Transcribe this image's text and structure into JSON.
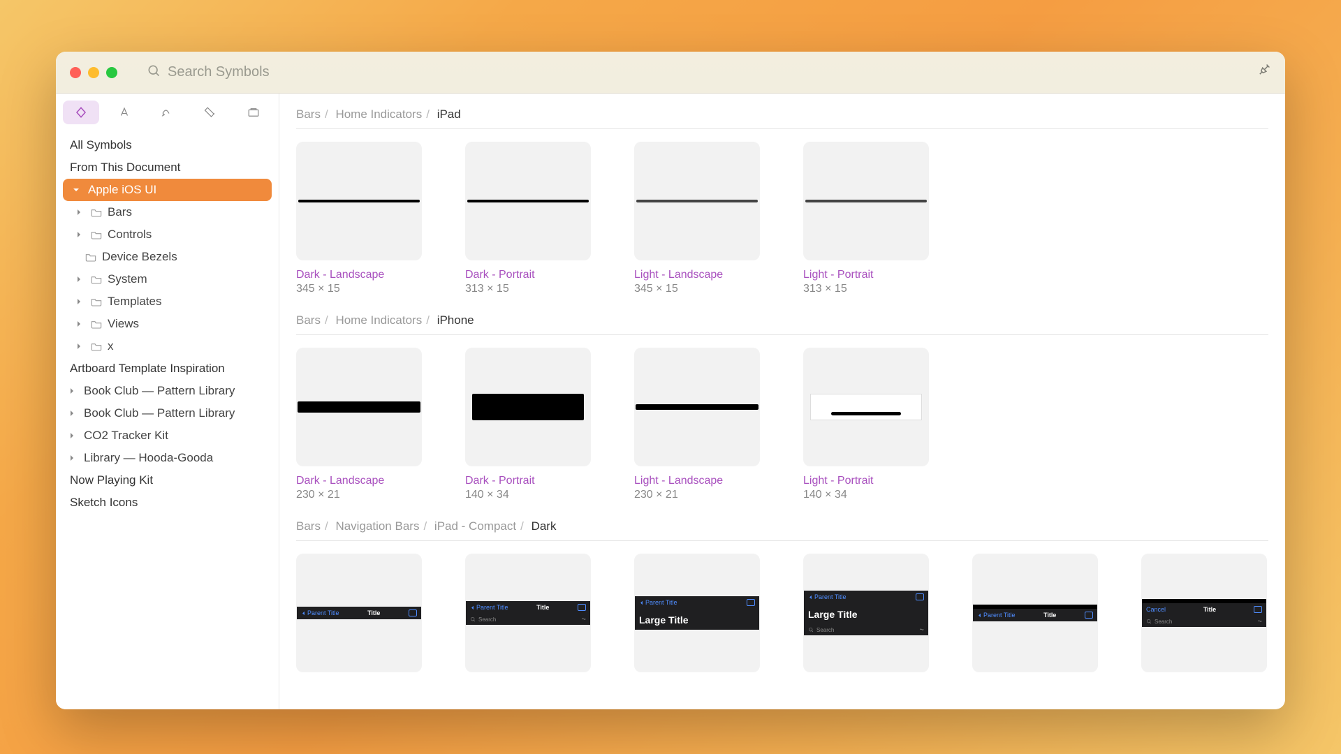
{
  "titlebar": {
    "search_placeholder": "Search Symbols"
  },
  "sidebar": {
    "all_symbols": "All Symbols",
    "from_doc": "From This Document",
    "apple_ios": "Apple iOS UI",
    "bars": "Bars",
    "controls": "Controls",
    "device_bezels": "Device Bezels",
    "system": "System",
    "templates": "Templates",
    "views": "Views",
    "x": "x",
    "artboard_inspiration": "Artboard Template Inspiration",
    "bookclub1": "Book Club — Pattern Library",
    "bookclub2": "Book Club — Pattern Library",
    "co2": "CO2 Tracker Kit",
    "hooda": "Library — Hooda-Gooda",
    "now_playing": "Now Playing Kit",
    "sketch_icons": "Sketch Icons"
  },
  "sections": {
    "s1": {
      "crumb1": "Bars",
      "crumb2": "Home Indicators",
      "crumb3": "iPad"
    },
    "s2": {
      "crumb1": "Bars",
      "crumb2": "Home Indicators",
      "crumb3": "iPhone"
    },
    "s3": {
      "crumb1": "Bars",
      "crumb2": "Navigation Bars",
      "crumb3": "iPad - Compact",
      "crumb4": "Dark"
    }
  },
  "ipad": {
    "c1": {
      "title": "Dark - Landscape",
      "dim": "345 × 15"
    },
    "c2": {
      "title": "Dark - Portrait",
      "dim": "313 × 15"
    },
    "c3": {
      "title": "Light - Landscape",
      "dim": "345 × 15"
    },
    "c4": {
      "title": "Light - Portrait",
      "dim": "313 × 15"
    }
  },
  "iphone": {
    "c1": {
      "title": "Dark - Landscape",
      "dim": "230 × 21"
    },
    "c2": {
      "title": "Dark - Portrait",
      "dim": "140 × 34"
    },
    "c3": {
      "title": "Light - Landscape",
      "dim": "230 × 21"
    },
    "c4": {
      "title": "Light - Portrait",
      "dim": "140 × 34"
    }
  },
  "nav": {
    "parent_title": "Parent Title",
    "title": "Title",
    "large_title": "Large Title",
    "search": "Search",
    "cancel": "Cancel"
  }
}
